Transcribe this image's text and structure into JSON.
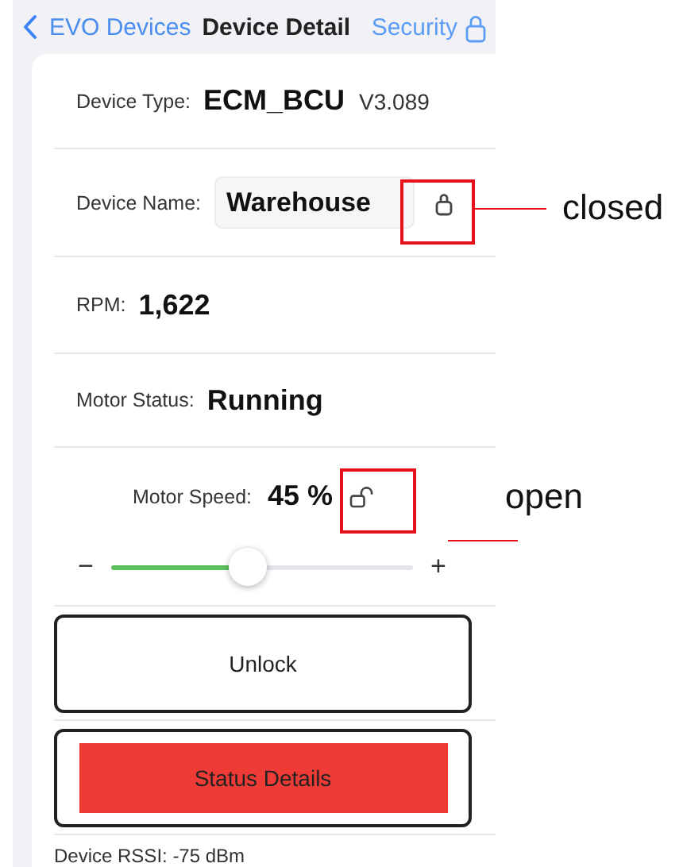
{
  "nav": {
    "back_label": "EVO Devices",
    "title": "Device Detail",
    "action_label": "Security"
  },
  "rows": [
    {
      "kind": "type",
      "label": "Device Type:",
      "value": "ECM_BCU",
      "version": "V3.089"
    },
    {
      "kind": "name",
      "label": "Device Name:",
      "value": "Warehouse",
      "locked": true
    },
    {
      "kind": "value",
      "label": "RPM:",
      "value": "1,622"
    },
    {
      "kind": "value",
      "label": "Motor Status:",
      "value": "Running"
    },
    {
      "kind": "slider",
      "label": "Motor Speed:",
      "value": "45 %",
      "locked": false,
      "minus": "−",
      "plus": "+",
      "level": 0.45
    }
  ],
  "buttons": [
    {
      "kind": "outline",
      "label": "Unlock"
    },
    {
      "kind": "filled",
      "label": "Status Details"
    }
  ],
  "footer": "Device RSSI: -75 dBm",
  "annotations": [
    {
      "label": "closed"
    },
    {
      "label": "open"
    }
  ]
}
